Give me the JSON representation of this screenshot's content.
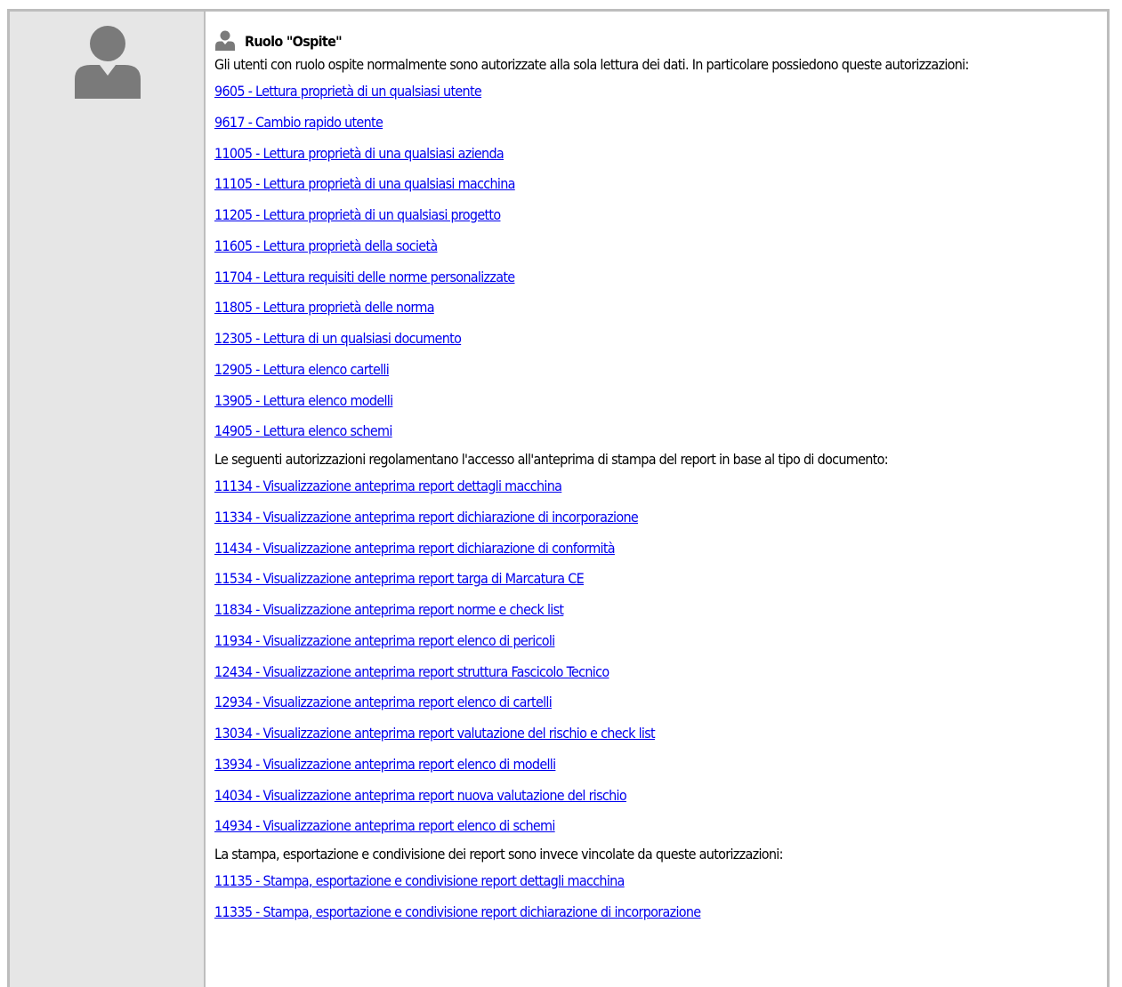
{
  "role": {
    "title": "Ruolo \"Ospite\"",
    "intro": "Gli utenti con ruolo ospite normalmente sono autorizzate alla sola lettura dei dati. In particolare possiedono queste autorizzazioni:",
    "reading_links": [
      "9605 - Lettura proprietà di un qualsiasi utente",
      "9617 - Cambio rapido utente",
      "11005 - Lettura proprietà di una qualsiasi azienda",
      "11105 - Lettura proprietà di una qualsiasi macchina",
      "11205 - Lettura proprietà di un qualsiasi progetto",
      "11605 - Lettura proprietà della società",
      "11704 - Lettura requisiti delle norme personalizzate",
      "11805 - Lettura proprietà delle norma",
      "12305 - Lettura di un qualsiasi documento",
      "12905 - Lettura elenco cartelli",
      "13905 - Lettura elenco modelli",
      "14905 - Lettura elenco schemi"
    ],
    "preview_text": "Le seguenti autorizzazioni regolamentano l'accesso all'anteprima di stampa del report in base al tipo di documento:",
    "preview_links": [
      "11134 - Visualizzazione anteprima report dettagli macchina",
      "11334 - Visualizzazione anteprima report dichiarazione di incorporazione",
      "11434 - Visualizzazione anteprima report dichiarazione di conformità",
      "11534 - Visualizzazione anteprima report targa di Marcatura CE",
      "11834 - Visualizzazione anteprima report norme e check list",
      "11934 - Visualizzazione anteprima report elenco di pericoli",
      "12434 - Visualizzazione anteprima report struttura Fascicolo Tecnico",
      "12934 - Visualizzazione anteprima report elenco di cartelli",
      "13034 - Visualizzazione anteprima report valutazione del rischio e check list",
      "13934 - Visualizzazione anteprima report elenco di modelli",
      "14034 - Visualizzazione anteprima report nuova valutazione del rischio",
      "14934 - Visualizzazione anteprima report elenco di schemi"
    ],
    "print_text": "La stampa, esportazione e condivisione dei report sono invece vincolate da queste autorizzazioni:",
    "print_links": [
      "11135 - Stampa, esportazione e condivisione report dettagli macchina",
      "11335 - Stampa, esportazione e condivisione report dichiarazione di incorporazione"
    ]
  },
  "icons": {
    "avatar": "user-silhouette-icon",
    "role": "user-icon"
  },
  "colors": {
    "link": "#0000ee",
    "sidebar": "#e6e6e6",
    "border": "#bdbdbd",
    "icon": "#7a7a7a"
  }
}
